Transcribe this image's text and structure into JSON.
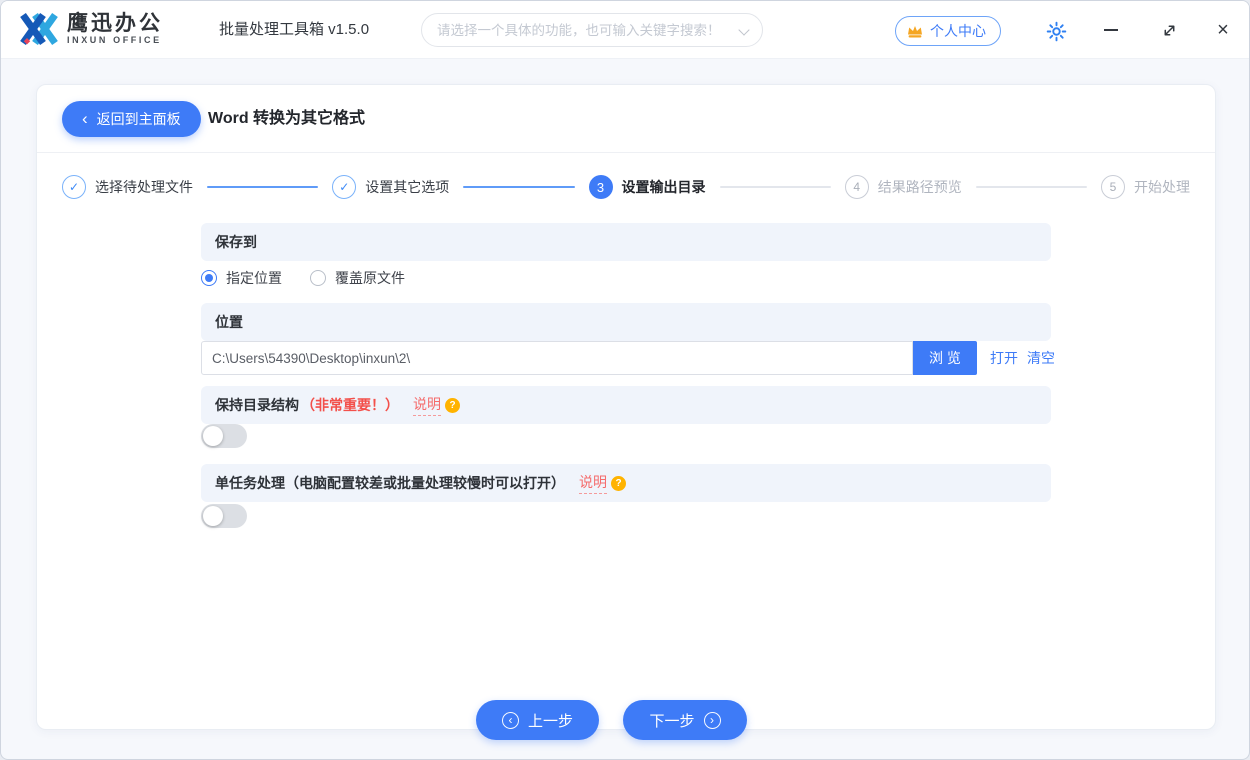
{
  "window_chrome": {
    "logo_cn": "鹰迅办公",
    "logo_en": "INXUN OFFICE",
    "app_title": "批量处理工具箱 v1.5.0",
    "search_placeholder": "请选择一个具体的功能，也可输入关键字搜索！",
    "user_center_label": "个人中心"
  },
  "header": {
    "back_label": "返回到主面板",
    "page_title": "Word 转换为其它格式"
  },
  "steps": {
    "items": [
      {
        "num": "1",
        "label": "选择待处理文件",
        "state": "done"
      },
      {
        "num": "2",
        "label": "设置其它选项",
        "state": "done"
      },
      {
        "num": "3",
        "label": "设置输出目录",
        "state": "active"
      },
      {
        "num": "4",
        "label": "结果路径预览",
        "state": "pending"
      },
      {
        "num": "5",
        "label": "开始处理",
        "state": "pending"
      }
    ]
  },
  "form": {
    "save_to": {
      "title": "保存到",
      "option_specified": "指定位置",
      "option_overwrite": "覆盖原文件",
      "selected": "指定位置"
    },
    "location": {
      "title": "位置",
      "path": "C:\\Users\\54390\\Desktop\\inxun\\2\\",
      "browse_label": "浏 览",
      "open_label": "打开",
      "clear_label": "清空"
    },
    "keep_structure": {
      "title": "保持目录结构",
      "important": "（非常重要！）",
      "help_label": "说明",
      "enabled": false
    },
    "single_task": {
      "title": "单任务处理（电脑配置较差或批量处理较慢时可以打开）",
      "help_label": "说明",
      "enabled": false
    }
  },
  "footer": {
    "prev_label": "上一步",
    "next_label": "下一步"
  },
  "icons": {
    "back_arrow": "‹",
    "check": "✓",
    "close": "×",
    "question": "?",
    "prev_arrow": "‹",
    "next_arrow": "›"
  },
  "colors": {
    "accent_blue": "#3e7bf7",
    "step_blue": "#3d8af7",
    "danger_red": "#f3504b",
    "link_red": "#f56c6c",
    "badge_orange": "#ffb300",
    "section_bg": "#f0f4fb",
    "toggle_off": "#dcdfe4"
  }
}
